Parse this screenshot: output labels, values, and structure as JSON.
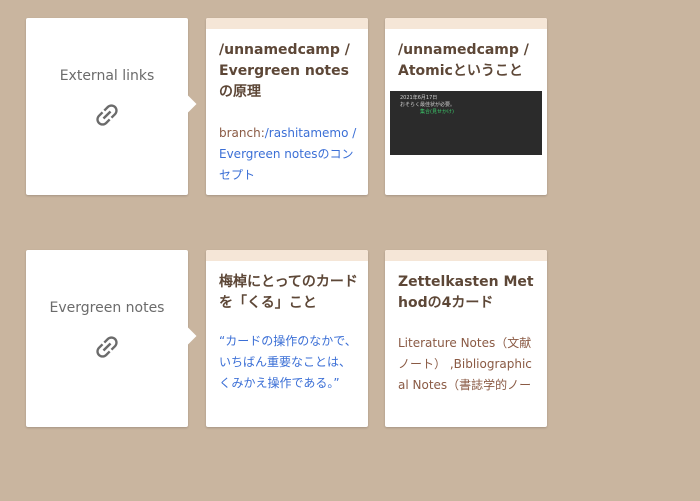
{
  "colors": {
    "background": "#c9b59f",
    "card": "#ffffff",
    "card_header": "#f5e6d7",
    "title": "#5d4737",
    "body_text": "#8a5a44",
    "link": "#3b6fd6",
    "icon": "#6b6b6b"
  },
  "rows": [
    {
      "relation": {
        "label": "External links",
        "icon": "link-icon"
      },
      "cards": [
        {
          "title": "/unnamedcamp /Evergreen notesの原理",
          "body_prefix": "branch:",
          "body_link": "/rashitamemo /Evergreen notesのコンセプト"
        },
        {
          "title": "/unnamedcamp /Atomicということ",
          "thumbnail": {
            "line1": "2021年6月17日",
            "line2": "おそらく最佳状が必要。",
            "line3": "集合(見せかけ)"
          }
        }
      ]
    },
    {
      "relation": {
        "label": "Evergreen notes",
        "icon": "link-icon"
      },
      "cards": [
        {
          "title": "梅棹にとってのカードを「くる」こと",
          "body_link": "“カードの操作のなかで、いちばん重要なことは、くみかえ操作である。”"
        },
        {
          "title": "Zettelkasten Methodの4カード",
          "body": "Literature Notes（文献ノート） ,Bibliographical Notes（書誌学的ノー"
        }
      ]
    }
  ]
}
